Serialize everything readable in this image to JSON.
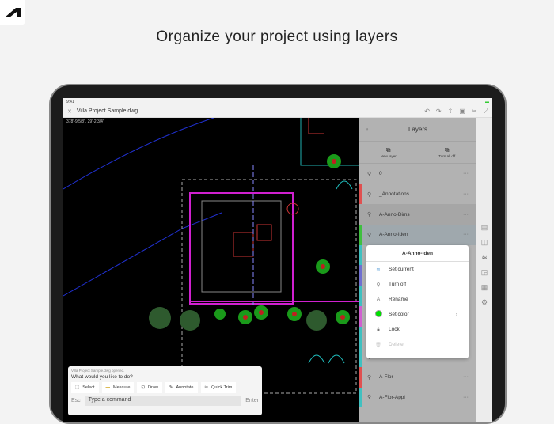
{
  "headline": "Organize your project using layers",
  "status": {
    "time": "9:41"
  },
  "file": {
    "title": "Villa Project Sample.dwg"
  },
  "canvas": {
    "coords": "378'-9 5/8\",  29'-2 3/4\""
  },
  "layers": {
    "title": "Layers",
    "new_layer": "New layer",
    "turn_all_off": "Turn all off",
    "rows": [
      {
        "name": "0",
        "color": "transparent"
      },
      {
        "name": "_Annotations",
        "color": "#e05050"
      },
      {
        "name": "A-Anno-Dims",
        "color": "transparent"
      },
      {
        "name": "A-Anno-Iden",
        "color": "#3fbf3f"
      },
      {
        "name": "",
        "color": "#40c0c0"
      },
      {
        "name": "",
        "color": "#7070d0"
      },
      {
        "name": "",
        "color": "#40c0c0"
      },
      {
        "name": "",
        "color": "#d060d0"
      },
      {
        "name": "",
        "color": "#40c0c0"
      },
      {
        "name": "",
        "color": "#40c0c0"
      },
      {
        "name": "A-Flor",
        "color": "#e05050"
      },
      {
        "name": "A-Flor-Appl",
        "color": "#40c0c0"
      }
    ]
  },
  "popup": {
    "title": "A-Anno-Iden",
    "items": [
      "Set current",
      "Turn off",
      "Rename",
      "Set color",
      "Lock",
      "Delete"
    ],
    "set_color": "#00e000"
  },
  "command": {
    "status": "Villa Project Sample.dwg opened.",
    "prompt": "What would you like to do?",
    "buttons": [
      "Select",
      "Measure",
      "Draw",
      "Annotate",
      "Quick Trim"
    ],
    "esc": "Esc",
    "placeholder": "Type a command",
    "enter": "Enter"
  }
}
